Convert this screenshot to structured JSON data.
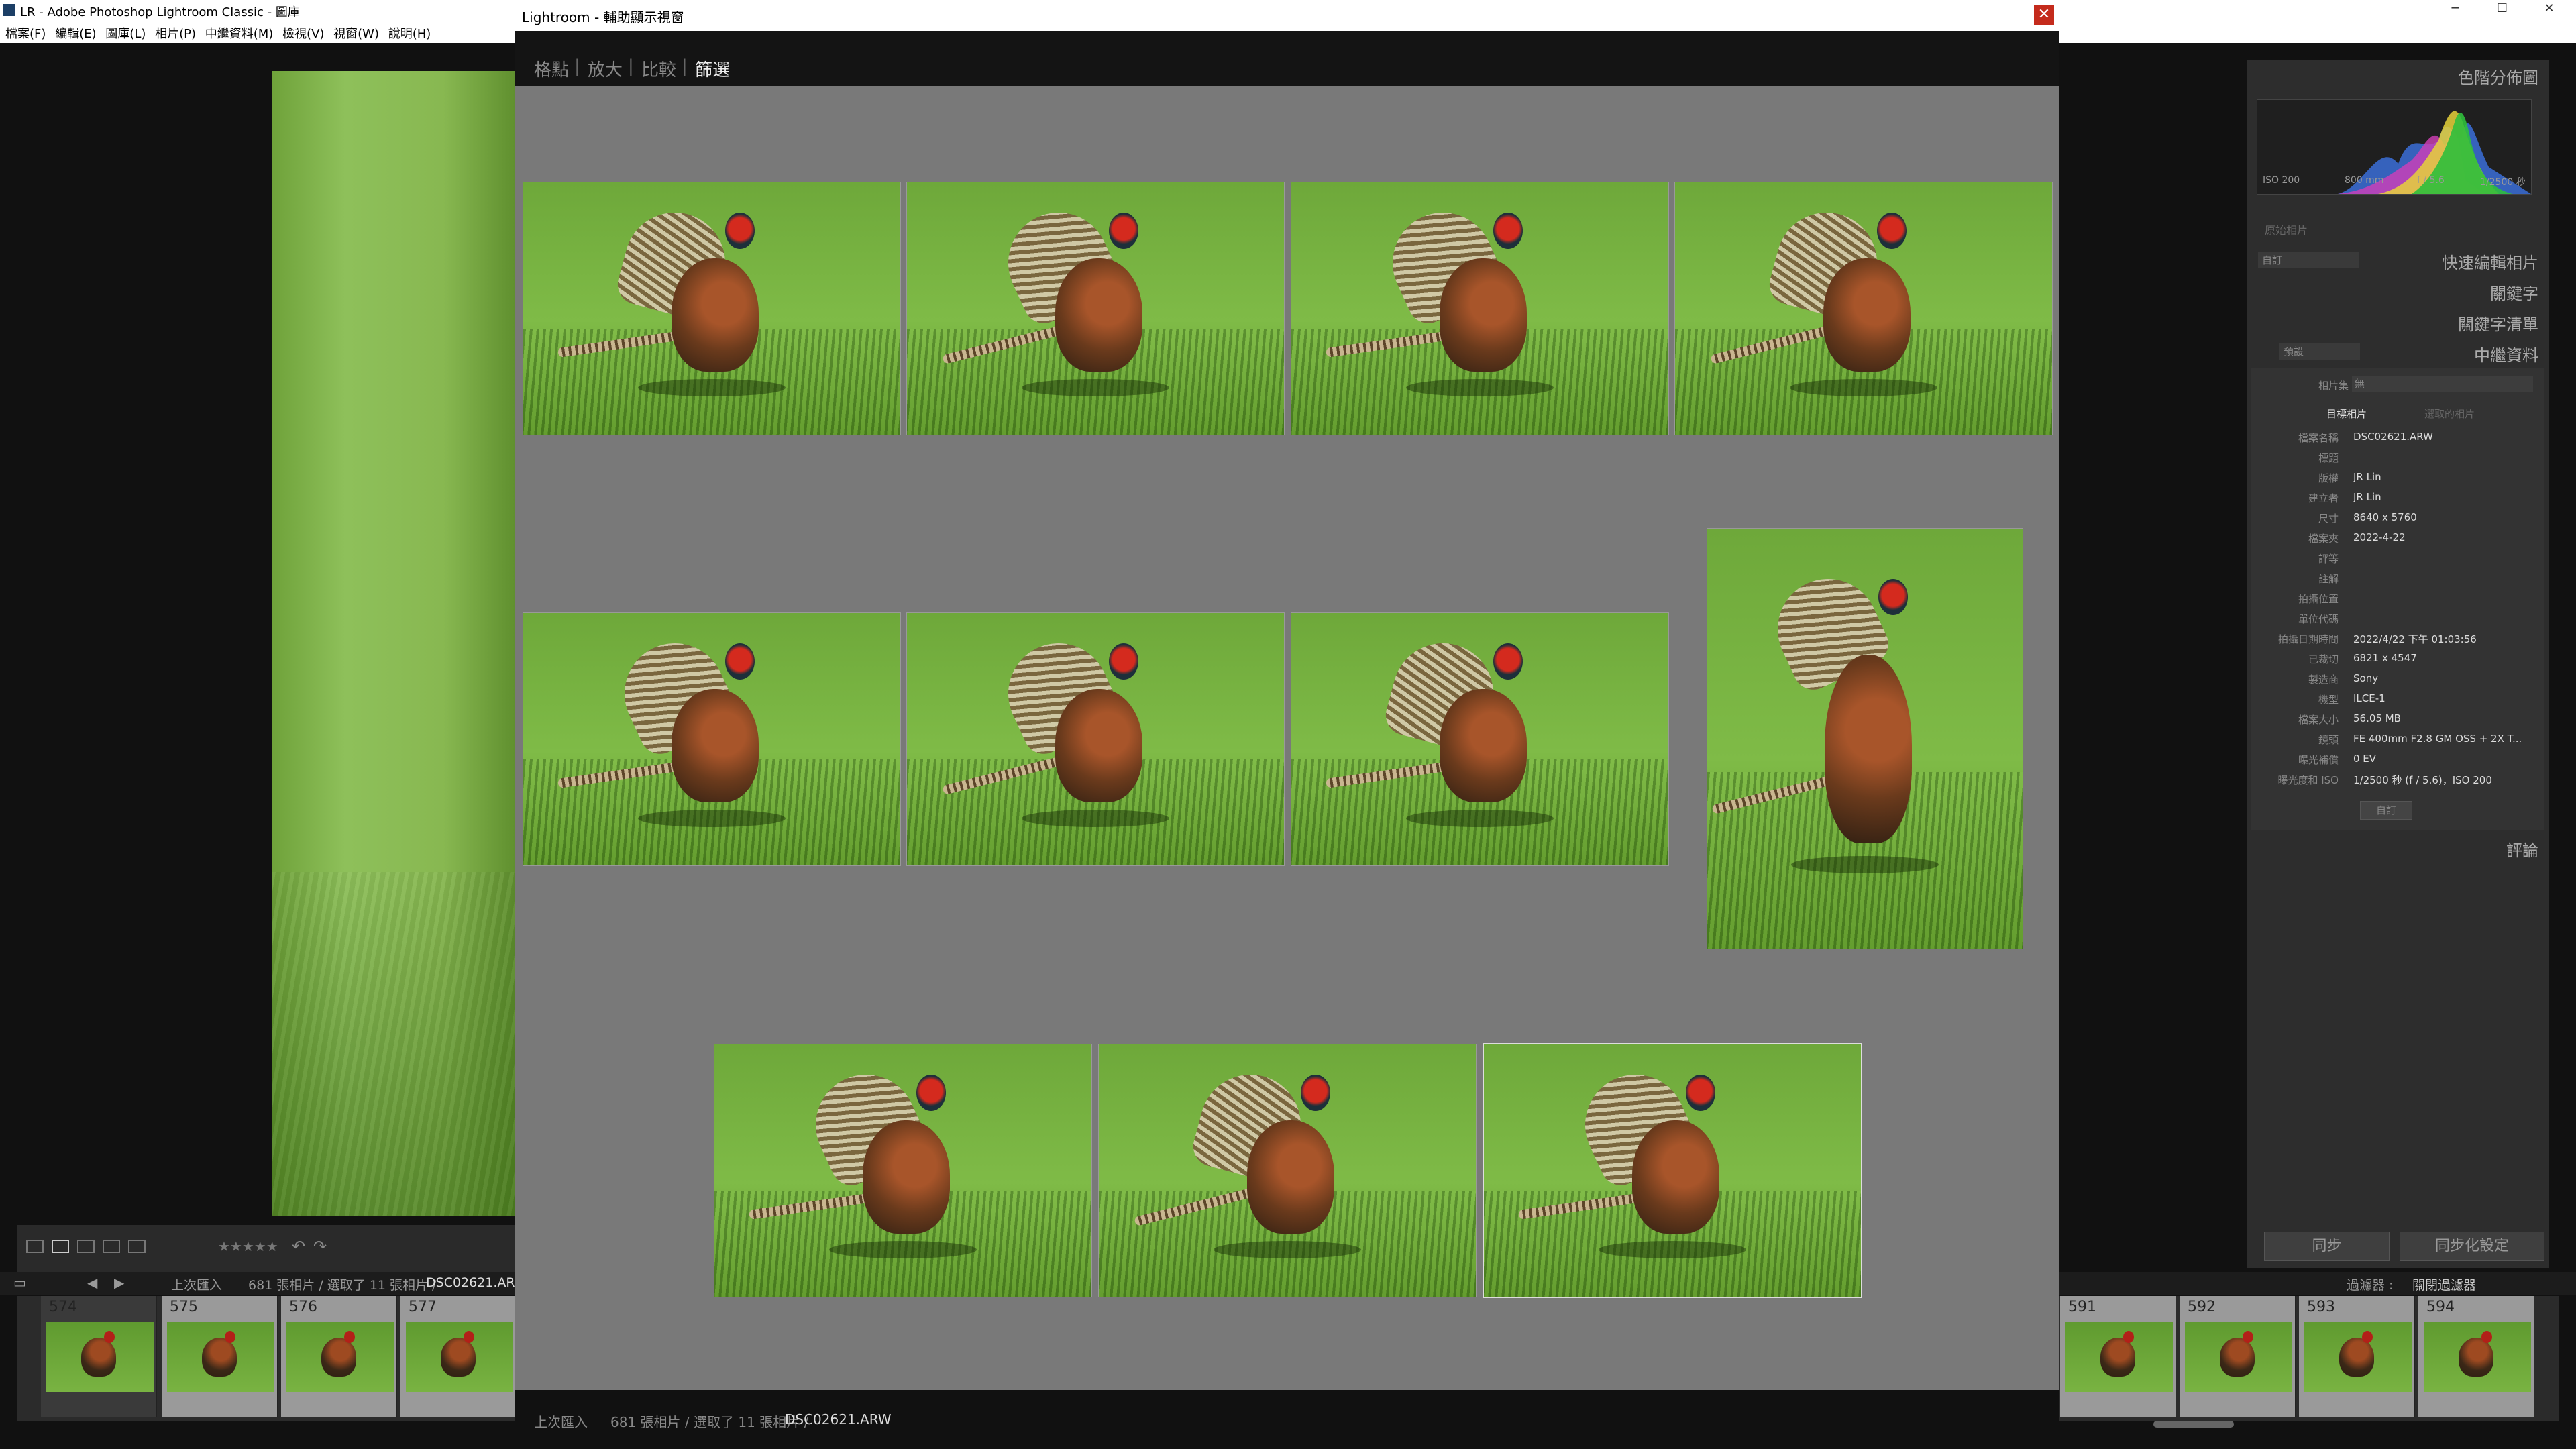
{
  "main_window": {
    "title": "LR - Adobe Photoshop Lightroom Classic - 圖庫",
    "controls": {
      "minimize": "─",
      "maximize": "☐",
      "close": "✕"
    },
    "menu": [
      "檔案(F)",
      "編輯(E)",
      "圖庫(L)",
      "相片(P)",
      "中繼資料(M)",
      "檢視(V)",
      "視窗(W)",
      "說明(H)"
    ]
  },
  "toolbar": {
    "stars": "★★★★★"
  },
  "filmstrip": {
    "source_label": "上次匯入",
    "status": "681 張相片 / 選取了 11 張相片 / ",
    "current_file": "DSC02621.ARW",
    "left_cells": [
      "574",
      "575",
      "576",
      "577"
    ],
    "right_cells": [
      "591",
      "592",
      "593",
      "594"
    ],
    "filter_label": "過濾器 :",
    "filter_value": "關閉過濾器"
  },
  "right_panel": {
    "histogram_title": "色階分佈圖",
    "histogram_info": {
      "iso": "ISO 200",
      "focal": "800 mm",
      "aperture": "f / 5.6",
      "shutter": "1/2500 秒"
    },
    "original_photo": "原始相片",
    "quick_develop_preset": "自訂",
    "quick_develop": "快速編輯相片",
    "keywords": "關鍵字",
    "keyword_list": "關鍵字清單",
    "metadata_preset": "預設",
    "metadata": "中繼資料",
    "photo_set_label": "相片集",
    "photo_set_value": "無",
    "target_tab": "目標相片",
    "selected_tab": "選取的相片",
    "rows": [
      {
        "k": "檔案名稱",
        "v": "DSC02621.ARW"
      },
      {
        "k": "標題",
        "v": ""
      },
      {
        "k": "版權",
        "v": "JR Lin"
      },
      {
        "k": "建立者",
        "v": "JR Lin"
      },
      {
        "k": "尺寸",
        "v": "8640 x 5760"
      },
      {
        "k": "檔案夾",
        "v": "2022-4-22"
      },
      {
        "k": "評等",
        "v": ""
      },
      {
        "k": "註解",
        "v": ""
      },
      {
        "k": "拍攝位置",
        "v": ""
      },
      {
        "k": "單位代碼",
        "v": ""
      },
      {
        "k": "拍攝日期時間",
        "v": "2022/4/22 下午 01:03:56"
      },
      {
        "k": "已裁切",
        "v": "6821 x 4547"
      },
      {
        "k": "製造商",
        "v": "Sony"
      },
      {
        "k": "機型",
        "v": "ILCE-1"
      },
      {
        "k": "檔案大小",
        "v": "56.05 MB"
      },
      {
        "k": "鏡頭",
        "v": "FE 400mm F2.8 GM OSS + 2X T..."
      },
      {
        "k": "曝光補償",
        "v": "0 EV"
      },
      {
        "k": "曝光度和 ISO",
        "v": "1/2500 秒 (f / 5.6)，ISO 200"
      }
    ],
    "custom_button": "自訂",
    "comments": "評論",
    "sync_button": "同步",
    "sync_settings_button": "同步化設定"
  },
  "secondary_window": {
    "title": "Lightroom - 輔助顯示視窗",
    "close": "✕",
    "modes": [
      "格點",
      "放大",
      "比較",
      "篩選"
    ],
    "active_mode": "篩選",
    "footer_source": "上次匯入",
    "footer_status": "681 張相片 / 選取了 11 張相片 / ",
    "footer_file": "DSC02621.ARW"
  },
  "colors": {
    "accent": "#c42b1c",
    "panel": "#2d2d2d",
    "survey_bg": "#797979",
    "selected_thumb": "#9a9a9a"
  }
}
